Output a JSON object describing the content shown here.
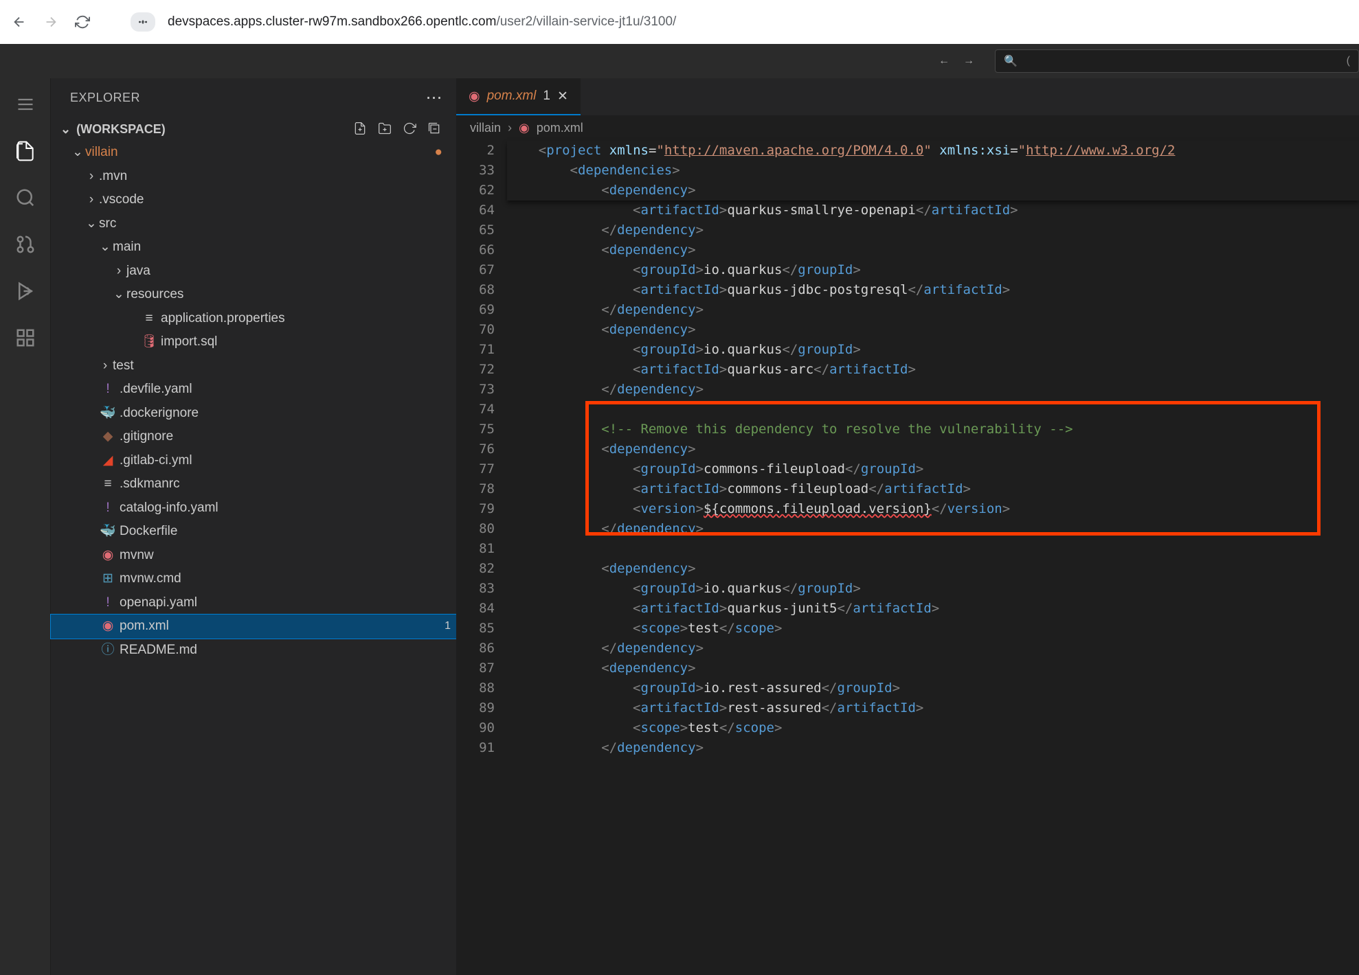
{
  "browser": {
    "host": "devspaces.apps.cluster-rw97m.sandbox266.opentlc.com",
    "path": "/user2/villain-service-jt1u/3100/"
  },
  "sidebar": {
    "title": "EXPLORER",
    "workspace_label": "(WORKSPACE)",
    "root": "villain",
    "tree": {
      "mvn": ".mvn",
      "vscode": ".vscode",
      "src": "src",
      "main": "main",
      "java": "java",
      "resources": "resources",
      "app_props": "application.properties",
      "import_sql": "import.sql",
      "test": "test",
      "devfile": ".devfile.yaml",
      "dockerignore": ".dockerignore",
      "gitignore": ".gitignore",
      "gitlab": ".gitlab-ci.yml",
      "sdkmanrc": ".sdkmanrc",
      "catalog": "catalog-info.yaml",
      "dockerfile": "Dockerfile",
      "mvnw": "mvnw",
      "mvnw_cmd": "mvnw.cmd",
      "openapi": "openapi.yaml",
      "pom": "pom.xml",
      "pom_badge": "1",
      "readme": "README.md"
    }
  },
  "editor": {
    "tab": {
      "name": "pom.xml",
      "modified": "1"
    },
    "breadcrumb": {
      "folder": "villain",
      "file": "pom.xml"
    }
  },
  "code": {
    "s2": {
      "ln": "2",
      "pre": "    ",
      "proj": "project",
      "xmlns": "xmlns",
      "eq": "=",
      "u1": "http://maven.apache.org/POM/4.0.0",
      "xsi": "xmlns:xsi",
      "u2": "http://www.w3.org/2"
    },
    "s33": {
      "ln": "33",
      "ind": "        ",
      "tag": "dependencies"
    },
    "s62": {
      "ln": "62",
      "ind": "            ",
      "tag": "dependency"
    },
    "l64": {
      "ln": "64",
      "ind": "                ",
      "tag": "artifactId",
      "txt": "quarkus-smallrye-openapi"
    },
    "l65": {
      "ln": "65",
      "ind": "            ",
      "tag": "dependency"
    },
    "l66": {
      "ln": "66",
      "ind": "            ",
      "tag": "dependency"
    },
    "l67": {
      "ln": "67",
      "ind": "                ",
      "tag": "groupId",
      "txt": "io.quarkus"
    },
    "l68": {
      "ln": "68",
      "ind": "                ",
      "tag": "artifactId",
      "txt": "quarkus-jdbc-postgresql"
    },
    "l69": {
      "ln": "69",
      "ind": "            ",
      "tag": "dependency"
    },
    "l70": {
      "ln": "70",
      "ind": "            ",
      "tag": "dependency"
    },
    "l71": {
      "ln": "71",
      "ind": "                ",
      "tag": "groupId",
      "txt": "io.quarkus"
    },
    "l72": {
      "ln": "72",
      "ind": "                ",
      "tag": "artifactId",
      "txt": "quarkus-arc"
    },
    "l73": {
      "ln": "73",
      "ind": "            ",
      "tag": "dependency"
    },
    "l74": {
      "ln": "74"
    },
    "l75": {
      "ln": "75",
      "ind": "            ",
      "txt": "<!-- Remove this dependency to resolve the vulnerability -->"
    },
    "l76": {
      "ln": "76",
      "ind": "            ",
      "tag": "dependency"
    },
    "l77": {
      "ln": "77",
      "ind": "                ",
      "tag": "groupId",
      "txt": "commons-fileupload"
    },
    "l78": {
      "ln": "78",
      "ind": "                ",
      "tag": "artifactId",
      "txt": "commons-fileupload"
    },
    "l79": {
      "ln": "79",
      "ind": "                ",
      "tag": "version",
      "txt": "${commons.fileupload.version}"
    },
    "l80": {
      "ln": "80",
      "ind": "            ",
      "tag": "dependency"
    },
    "l81": {
      "ln": "81"
    },
    "l82": {
      "ln": "82",
      "ind": "            ",
      "tag": "dependency"
    },
    "l83": {
      "ln": "83",
      "ind": "                ",
      "tag": "groupId",
      "txt": "io.quarkus"
    },
    "l84": {
      "ln": "84",
      "ind": "                ",
      "tag": "artifactId",
      "txt": "quarkus-junit5"
    },
    "l85": {
      "ln": "85",
      "ind": "                ",
      "tag": "scope",
      "txt": "test"
    },
    "l86": {
      "ln": "86",
      "ind": "            ",
      "tag": "dependency"
    },
    "l87": {
      "ln": "87",
      "ind": "            ",
      "tag": "dependency"
    },
    "l88": {
      "ln": "88",
      "ind": "                ",
      "tag": "groupId",
      "txt": "io.rest-assured"
    },
    "l89": {
      "ln": "89",
      "ind": "                ",
      "tag": "artifactId",
      "txt": "rest-assured"
    },
    "l90": {
      "ln": "90",
      "ind": "                ",
      "tag": "scope",
      "txt": "test"
    },
    "l91": {
      "ln": "91",
      "ind": "            ",
      "tag": "dependency"
    }
  }
}
